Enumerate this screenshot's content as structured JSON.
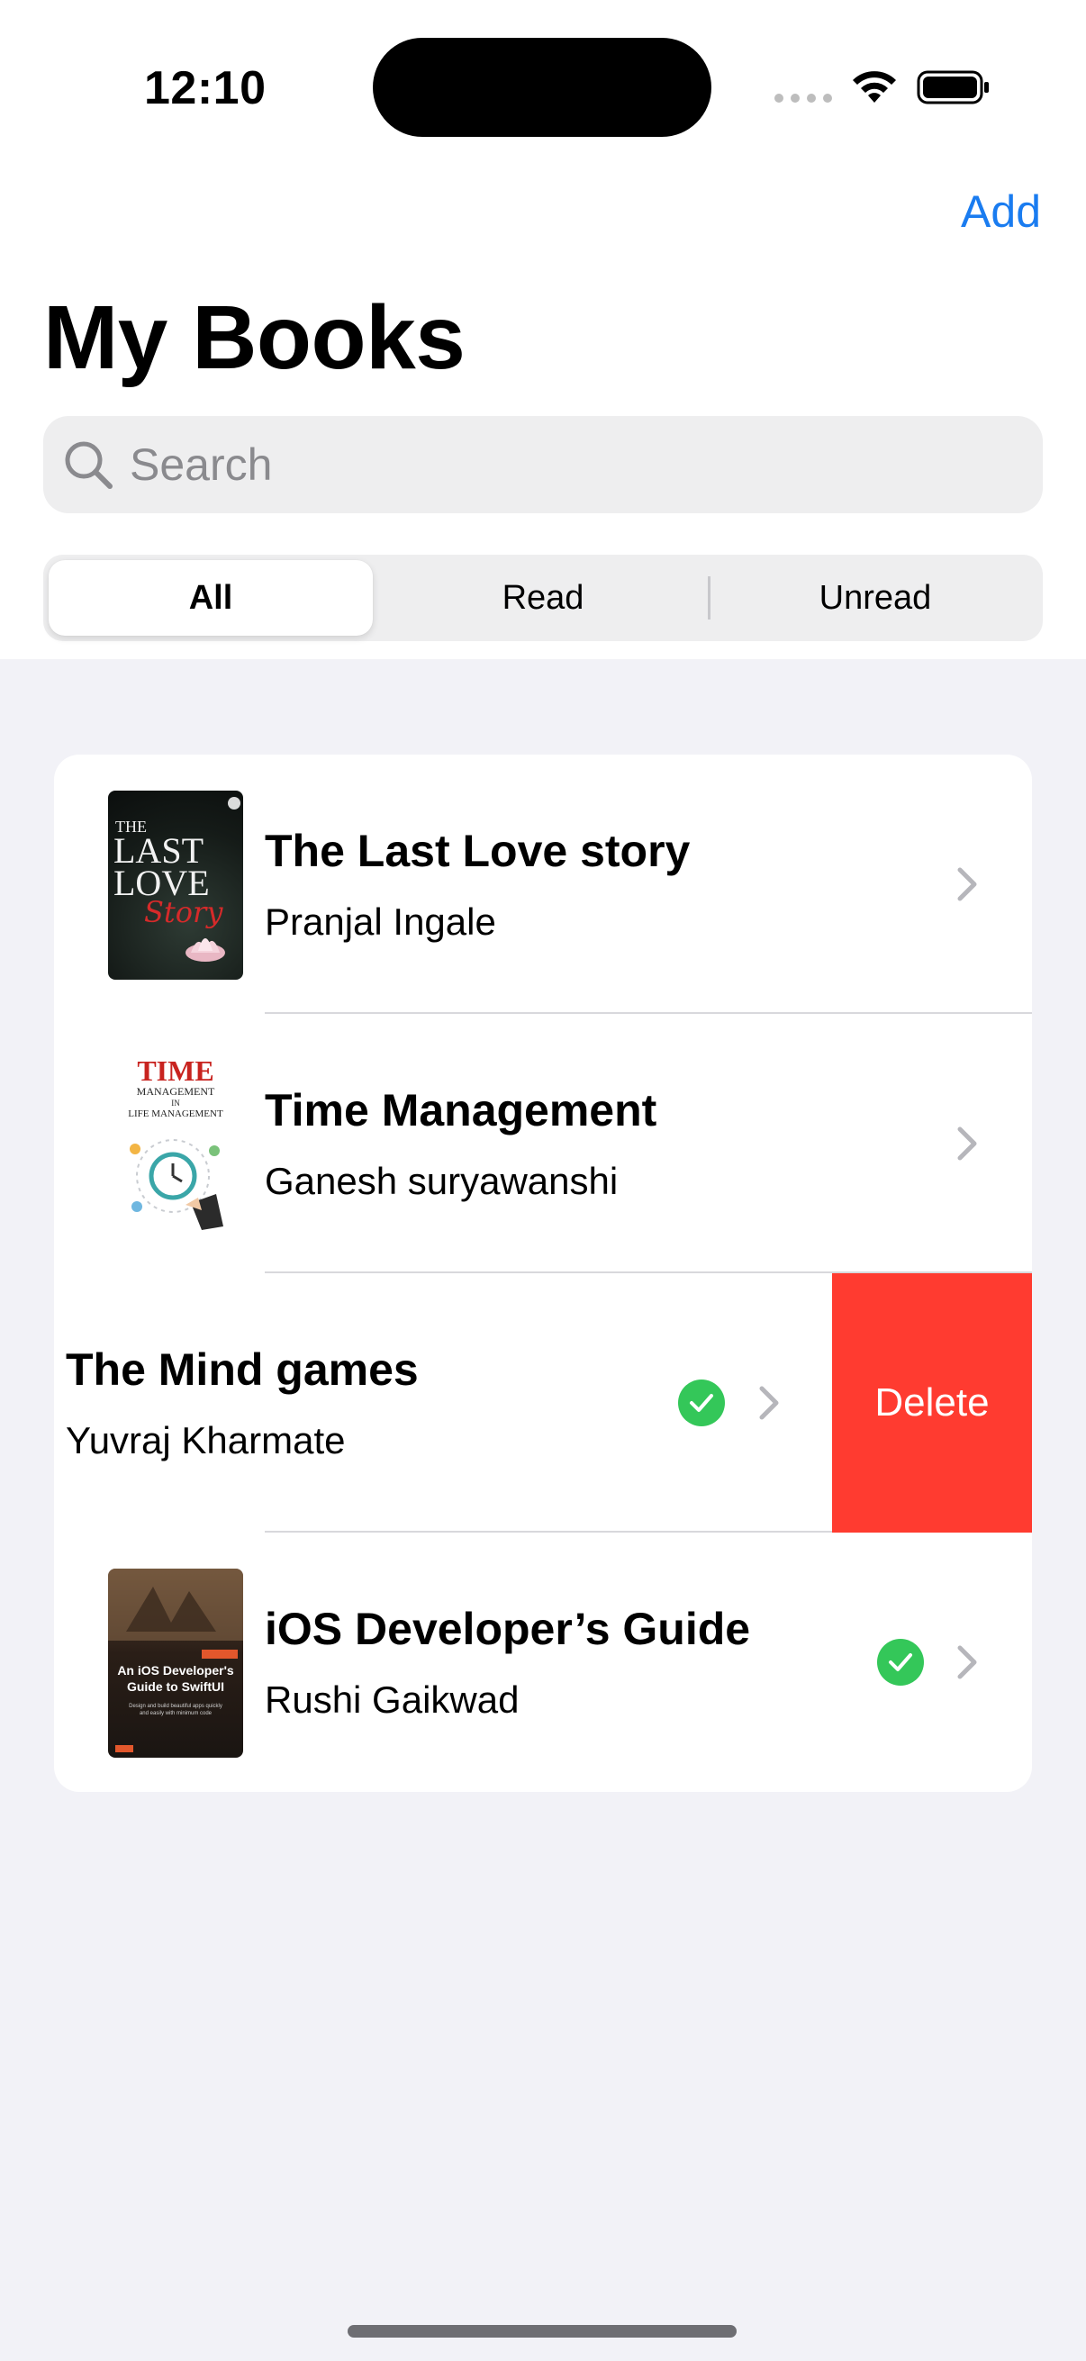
{
  "status_bar": {
    "time": "12:10"
  },
  "nav": {
    "add_label": "Add",
    "title": "My Books"
  },
  "search": {
    "placeholder": "Search"
  },
  "filter": {
    "options": [
      "All",
      "Read",
      "Unread"
    ],
    "selected": "All"
  },
  "books": [
    {
      "title": "The Last Love story",
      "author": "Pranjal Ingale",
      "read": false,
      "cover": {
        "lines": [
          "THE",
          "LAST",
          "LOVE"
        ],
        "script": "Story"
      }
    },
    {
      "title": "Time Management",
      "author": "Ganesh suryawanshi",
      "read": false,
      "cover": {
        "brand": "TIME",
        "sub1": "MANAGEMENT",
        "sub2": "IN",
        "sub3": "LIFE MANAGEMENT"
      }
    },
    {
      "title": "The Mind games",
      "author": "Yuvraj Kharmate",
      "read": true,
      "swiped": true
    },
    {
      "title": "iOS Developer’s Guide",
      "author": "Rushi Gaikwad",
      "read": true,
      "cover": {
        "line1": "An iOS Developer's",
        "line2": "Guide to SwiftUI",
        "fine1": "Design and build beautiful apps quickly",
        "fine2": "and easily with minimum code"
      }
    }
  ],
  "swipe_action": {
    "delete_label": "Delete"
  },
  "colors": {
    "accent": "#1a7cf0",
    "delete": "#ff3b30",
    "check": "#34c759"
  }
}
